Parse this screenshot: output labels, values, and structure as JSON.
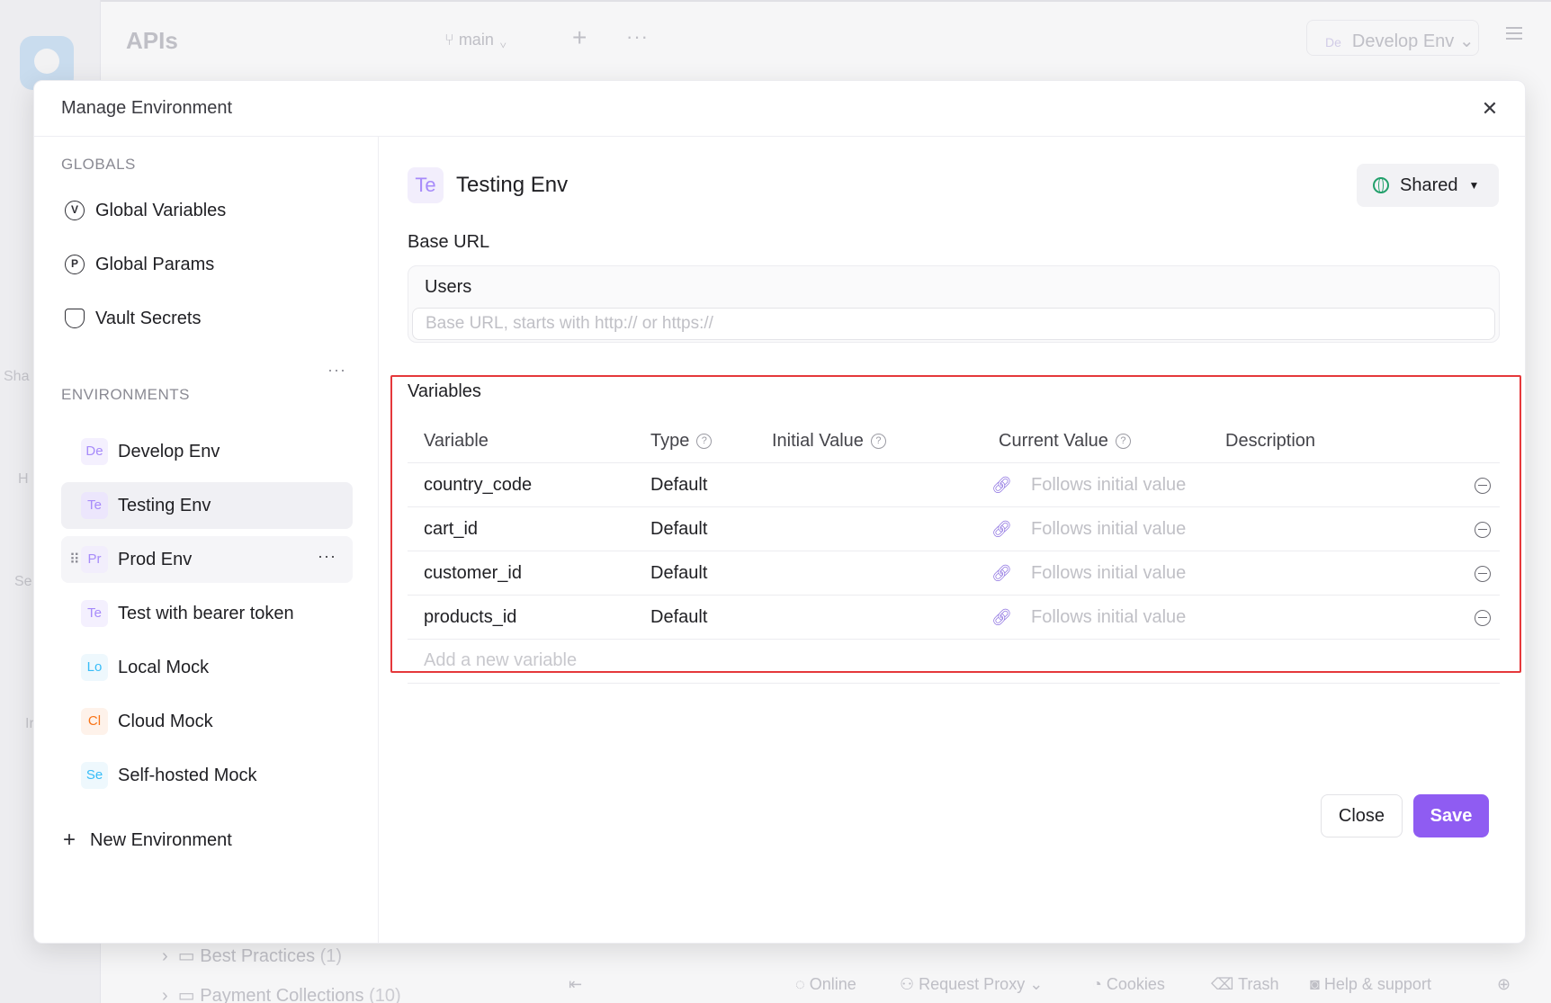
{
  "background": {
    "title": "APIs",
    "branch": "main",
    "env_prefix": "De",
    "env_name": "Develop Env",
    "side_labels": [
      "Sha",
      "H",
      "Se",
      "Ir"
    ],
    "tree": [
      {
        "name": "Best Practices",
        "count": "(1)"
      },
      {
        "name": "Payment Collections",
        "count": "(10)"
      }
    ],
    "status": {
      "online": "Online",
      "proxy": "Request Proxy",
      "cookies": "Cookies",
      "trash": "Trash",
      "help": "Help & support"
    }
  },
  "modal": {
    "title": "Manage Environment",
    "close_glyph": "✕"
  },
  "sidebar": {
    "globals_label": "GLOBALS",
    "globals": [
      {
        "label": "Global Variables",
        "icon": "V"
      },
      {
        "label": "Global Params",
        "icon": "P"
      },
      {
        "label": "Vault Secrets",
        "icon": "⛉"
      }
    ],
    "environments_label": "ENVIRONMENTS",
    "environments": [
      {
        "prefix": "De",
        "label": "Develop Env",
        "color": "#a78bfa",
        "bg": "#f4f0fe"
      },
      {
        "prefix": "Te",
        "label": "Testing Env",
        "color": "#a78bfa",
        "bg": "#ece6fc"
      },
      {
        "prefix": "Pr",
        "label": "Prod Env",
        "color": "#a78bfa",
        "bg": "#f2eefc"
      },
      {
        "prefix": "Te",
        "label": "Test with bearer token",
        "color": "#a78bfa",
        "bg": "#f4f0fe"
      },
      {
        "prefix": "Lo",
        "label": "Local Mock",
        "color": "#38bdf8",
        "bg": "#eef8fd"
      },
      {
        "prefix": "Cl",
        "label": "Cloud Mock",
        "color": "#f97316",
        "bg": "#fef2ea"
      },
      {
        "prefix": "Se",
        "label": "Self-hosted Mock",
        "color": "#38bdf8",
        "bg": "#eef8fd"
      }
    ],
    "new_env_label": "New Environment"
  },
  "main": {
    "env_prefix": "Te",
    "env_name": "Testing Env",
    "shared_label": "Shared",
    "base_url_label": "Base URL",
    "base_url_service": "Users",
    "base_url_placeholder": "Base URL, starts with http:// or https://",
    "variables_label": "Variables",
    "columns": [
      "Variable",
      "Type",
      "Initial Value",
      "Current Value",
      "Description"
    ],
    "variables": [
      {
        "name": "country_code",
        "type": "Default",
        "initial": "",
        "current": "Follows initial value",
        "description": ""
      },
      {
        "name": "cart_id",
        "type": "Default",
        "initial": "",
        "current": "Follows initial value",
        "description": ""
      },
      {
        "name": "customer_id",
        "type": "Default",
        "initial": "",
        "current": "Follows initial value",
        "description": ""
      },
      {
        "name": "products_id",
        "type": "Default",
        "initial": "",
        "current": "Follows initial value",
        "description": ""
      }
    ],
    "add_variable_placeholder": "Add a new variable",
    "close_label": "Close",
    "save_label": "Save"
  }
}
